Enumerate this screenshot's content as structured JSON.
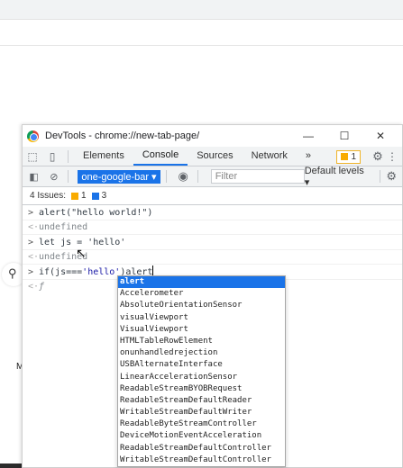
{
  "devtools": {
    "title": "DevTools - chrome://new-tab-page/",
    "window_controls": [
      "—",
      "☐",
      "✕"
    ],
    "tabs": [
      {
        "label": "Elements"
      },
      {
        "label": "Console",
        "active": true
      },
      {
        "label": "Sources"
      },
      {
        "label": "Network"
      }
    ],
    "more_tabs": "»",
    "issues_badge_count": "1",
    "toolbar": {
      "context": "one-google-bar ▾",
      "filter_placeholder": "Filter",
      "levels": "Default levels ▾"
    },
    "issues_bar": {
      "label": "4 Issues:",
      "warning_count": "1",
      "info_count": "3"
    },
    "console": [
      {
        "type": "input",
        "prefix": ">",
        "text": "alert(\"hello world!\")"
      },
      {
        "type": "result",
        "prefix": "<·",
        "text": "undefined"
      },
      {
        "type": "input",
        "prefix": ">",
        "text": "let js = 'hello'"
      },
      {
        "type": "result",
        "prefix": "<·",
        "text": "undefined"
      },
      {
        "type": "input",
        "prefix": ">",
        "text_before": "if(js===",
        "text_string": "'hello'",
        "text_after": ")alert"
      },
      {
        "type": "result",
        "prefix": "<·",
        "text": "ƒ"
      }
    ],
    "autocomplete": [
      "alert",
      "Accelerometer",
      "AbsoluteOrientationSensor",
      "visualViewport",
      "VisualViewport",
      "HTMLTableRowElement",
      "onunhandledrejection",
      "USBAlternateInterface",
      "LinearAccelerationSensor",
      "ReadableStreamBYOBRequest",
      "ReadableStreamDefaultReader",
      "WritableStreamDefaultWriter",
      "ReadableByteStreamController",
      "DeviceMotionEventAcceleration",
      "ReadableStreamDefaultController",
      "WritableStreamDefaultController"
    ]
  },
  "background": {
    "search_icon": "search-icon",
    "letter": "M"
  },
  "colors": {
    "accent": "#1a73e8",
    "warning": "#f9ab00"
  }
}
